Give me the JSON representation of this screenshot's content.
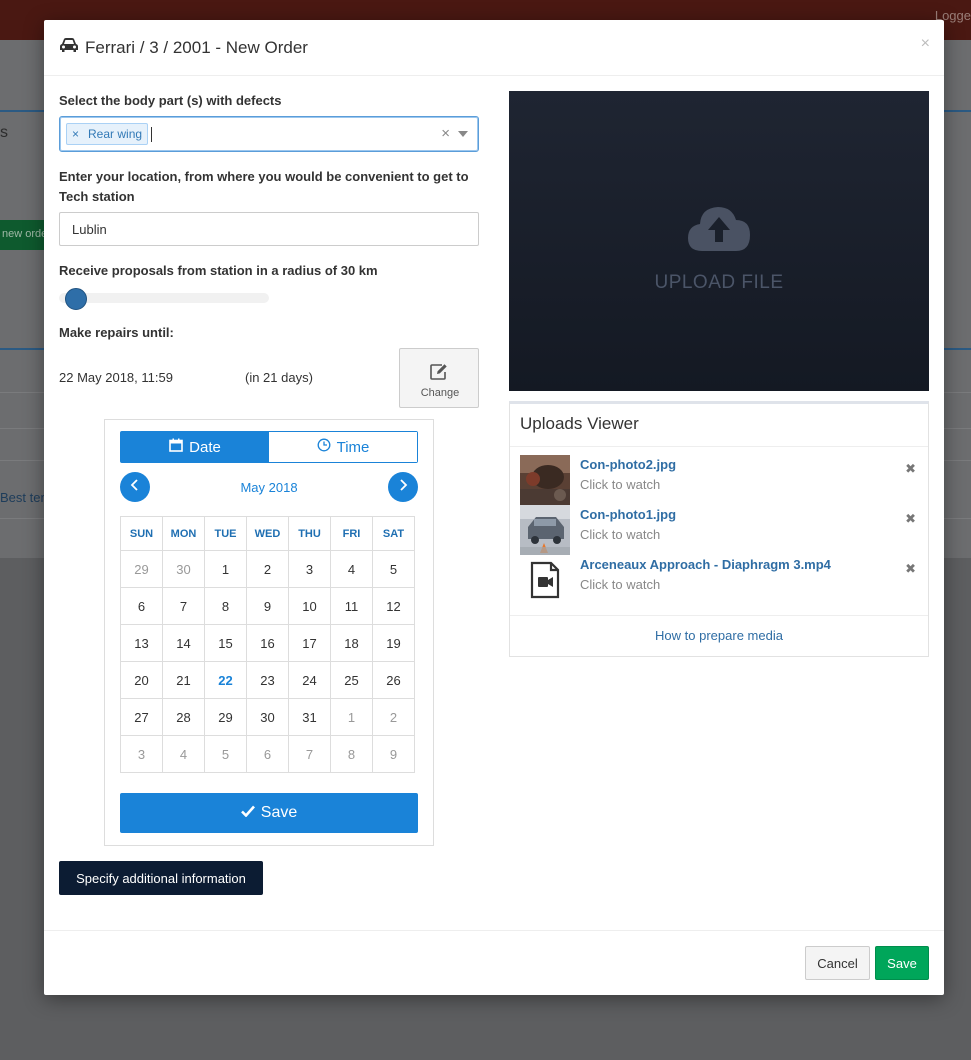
{
  "background": {
    "logged_text": "Logge",
    "left_s": "s",
    "new_order_fragment": "new orde",
    "best_fragment": "Best ter"
  },
  "modal": {
    "title": "Ferrari / 3 / 2001 - New Order",
    "title_icon": "car-icon",
    "close_label": "×"
  },
  "body_part": {
    "label": "Select the body part (s) with defects",
    "tags": [
      "Rear wing"
    ],
    "tag_remove": "×",
    "clear": "×"
  },
  "location": {
    "label": "Enter your location, from where you would be convenient to get to Tech station",
    "value": "Lublin"
  },
  "radius": {
    "label": "Receive proposals from station in a radius of 30 km",
    "value_km": 30,
    "slider_fraction": 0.04
  },
  "repairs": {
    "label": "Make repairs until:",
    "date": "22 May 2018, 11:59",
    "relative": "(in 21 days)",
    "change_label": "Change"
  },
  "calendar": {
    "tab_date": "Date",
    "tab_time": "Time",
    "month": "May 2018",
    "weekdays": [
      "SUN",
      "MON",
      "TUE",
      "WED",
      "THU",
      "FRI",
      "SAT"
    ],
    "weeks": [
      [
        {
          "d": "29",
          "m": true
        },
        {
          "d": "30",
          "m": true
        },
        {
          "d": "1"
        },
        {
          "d": "2"
        },
        {
          "d": "3"
        },
        {
          "d": "4"
        },
        {
          "d": "5"
        }
      ],
      [
        {
          "d": "6"
        },
        {
          "d": "7"
        },
        {
          "d": "8"
        },
        {
          "d": "9"
        },
        {
          "d": "10"
        },
        {
          "d": "11"
        },
        {
          "d": "12"
        }
      ],
      [
        {
          "d": "13"
        },
        {
          "d": "14"
        },
        {
          "d": "15"
        },
        {
          "d": "16"
        },
        {
          "d": "17"
        },
        {
          "d": "18"
        },
        {
          "d": "19"
        }
      ],
      [
        {
          "d": "20"
        },
        {
          "d": "21"
        },
        {
          "d": "22",
          "s": true
        },
        {
          "d": "23"
        },
        {
          "d": "24"
        },
        {
          "d": "25"
        },
        {
          "d": "26"
        }
      ],
      [
        {
          "d": "27"
        },
        {
          "d": "28"
        },
        {
          "d": "29"
        },
        {
          "d": "30"
        },
        {
          "d": "31"
        },
        {
          "d": "1",
          "m": true
        },
        {
          "d": "2",
          "m": true
        }
      ],
      [
        {
          "d": "3",
          "m": true
        },
        {
          "d": "4",
          "m": true
        },
        {
          "d": "5",
          "m": true
        },
        {
          "d": "6",
          "m": true
        },
        {
          "d": "7",
          "m": true
        },
        {
          "d": "8",
          "m": true
        },
        {
          "d": "9",
          "m": true
        }
      ]
    ],
    "save_label": "Save"
  },
  "specify_label": "Specify additional information",
  "upload": {
    "label": "UPLOAD FILE"
  },
  "uploads_viewer": {
    "title": "Uploads Viewer",
    "items": [
      {
        "name": "Con-photo2.jpg",
        "sub": "Click to watch",
        "remove": "✖"
      },
      {
        "name": "Con-photo1.jpg",
        "sub": "Click to watch",
        "remove": "✖"
      },
      {
        "name": "Arceneaux Approach - Diaphragm 3.mp4",
        "sub": "Click to watch",
        "remove": "✖"
      }
    ],
    "footer_link": "How to prepare media"
  },
  "footer": {
    "cancel": "Cancel",
    "save": "Save"
  },
  "colors": {
    "primary": "#1a83d8",
    "success": "#00a65a",
    "dark_button": "#0c1c33",
    "link": "#2f6da4"
  }
}
